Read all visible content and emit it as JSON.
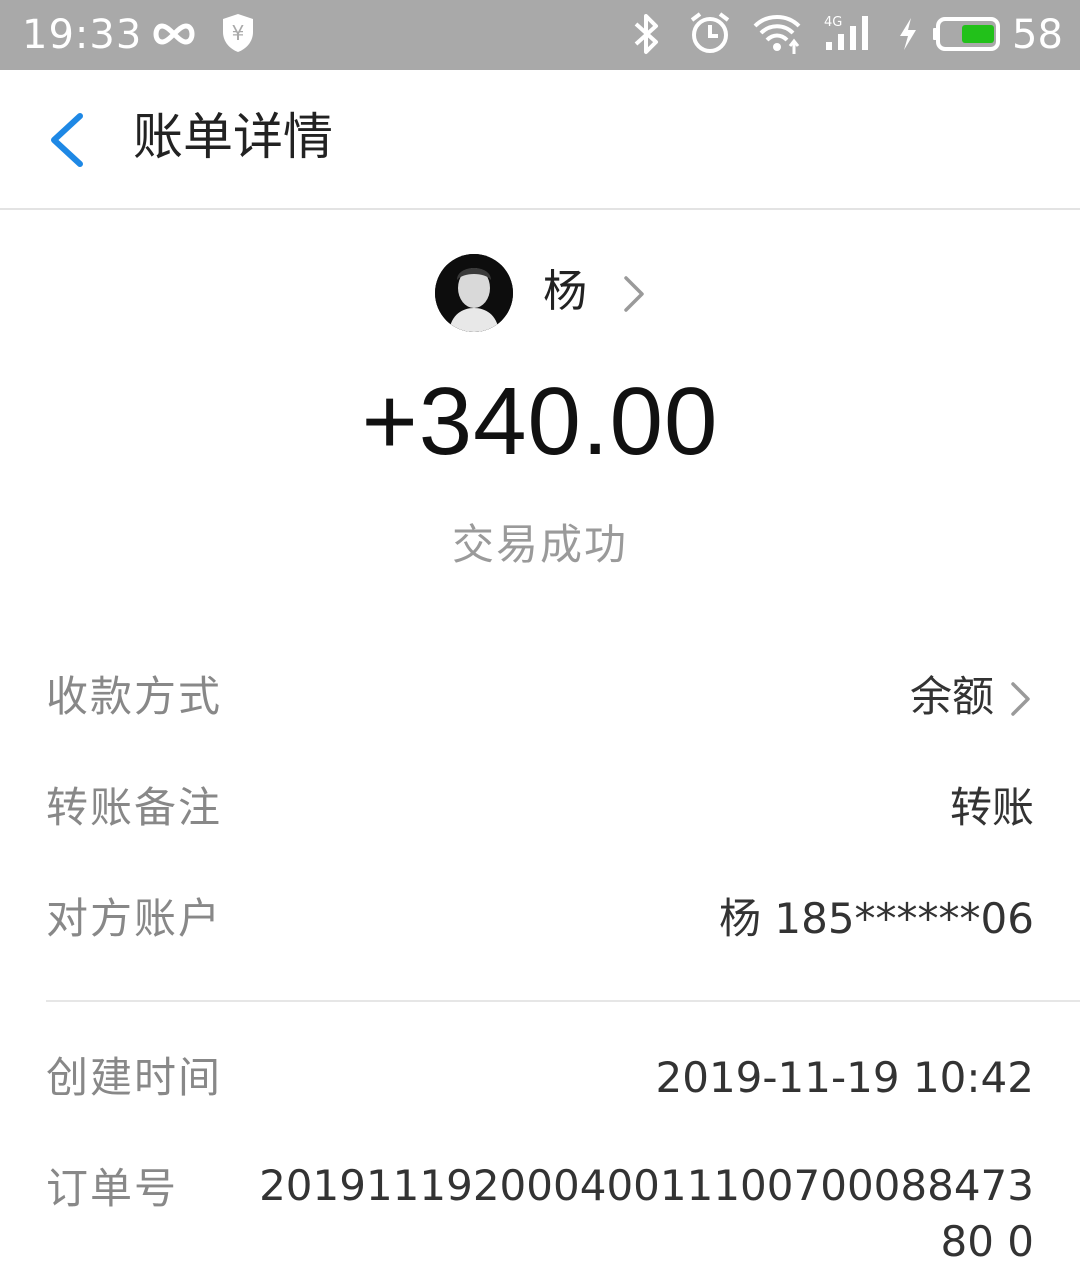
{
  "status_bar": {
    "time": "19:33",
    "battery_level": "58",
    "icons": [
      "infinity-icon",
      "shield-yen-icon",
      "bluetooth-icon",
      "alarm-icon",
      "wifi-icon",
      "4g-signal-icon",
      "charging-icon",
      "battery-icon"
    ],
    "battery_fill_color": "#22c11a"
  },
  "nav": {
    "title": "账单详情",
    "back_icon": "chevron-left-icon",
    "accent_color": "#1e88e5"
  },
  "header": {
    "contact_name": "杨",
    "amount": "+340.00",
    "status": "交易成功"
  },
  "details": [
    {
      "label": "收款方式",
      "value": "余额"
    },
    {
      "label": "转账备注",
      "value": "转账"
    },
    {
      "label": "对方账户",
      "value": "杨 185******06"
    },
    {
      "label": "创建时间",
      "value": "2019-11-19 10:42"
    },
    {
      "label": "订单号",
      "value": "2019111920004001110070008847380 0"
    }
  ]
}
